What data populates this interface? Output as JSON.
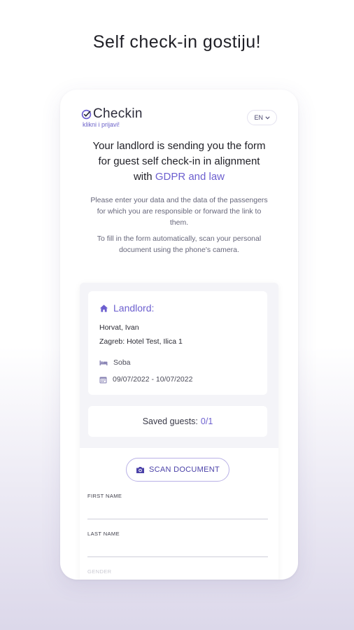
{
  "headline": "Self check-in gostiju!",
  "app": {
    "logo_text": "Checkin",
    "tagline": "klikni i prijavi!",
    "language": "EN"
  },
  "intro": {
    "text": "Your landlord is sending you the form for guest self check-in in alignment with ",
    "link": "GDPR and law",
    "paragraph1": "Please enter your data and the data of the passengers for which you are responsible or forward the link to them.",
    "paragraph2": "To fill in the form automatically, scan your personal document using the phone's camera."
  },
  "landlord": {
    "title": "Landlord:",
    "name": "Horvat, Ivan",
    "address": "Zagreb: Hotel Test, Ilica 1",
    "room": "Soba",
    "dates": "09/07/2022 - 10/07/2022"
  },
  "saved_guests": {
    "label": "Saved guests:",
    "count": "0/1"
  },
  "form": {
    "scan_button": "SCAN DOCUMENT",
    "first_name_label": "FIRST NAME",
    "last_name_label": "LAST NAME",
    "third_label": "GENDER"
  },
  "colors": {
    "accent": "#6c5fcf",
    "text": "#1f1f26"
  }
}
